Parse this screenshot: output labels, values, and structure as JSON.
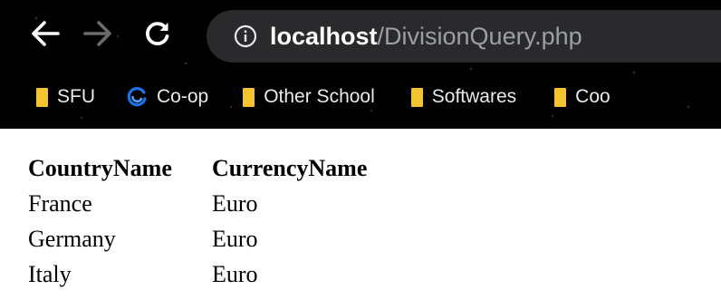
{
  "browser": {
    "url_host": "localhost",
    "url_path": "/DivisionQuery.php",
    "bookmarks": [
      {
        "label": "SFU",
        "icon": "folder-icon"
      },
      {
        "label": "Co-op",
        "icon": "refresh-circle-icon"
      },
      {
        "label": "Other School",
        "icon": "folder-icon"
      },
      {
        "label": "Softwares",
        "icon": "folder-icon"
      },
      {
        "label": "Coo",
        "icon": "folder-icon"
      }
    ],
    "colors": {
      "folder": "#f4c430",
      "chrome_bg": "#000000",
      "omnibox": "#2a2a2c",
      "coop_icon": "#1a73e8"
    }
  },
  "table": {
    "headers": [
      "CountryName",
      "CurrencyName"
    ],
    "rows": [
      [
        "France",
        "Euro"
      ],
      [
        "Germany",
        "Euro"
      ],
      [
        "Italy",
        "Euro"
      ]
    ]
  }
}
